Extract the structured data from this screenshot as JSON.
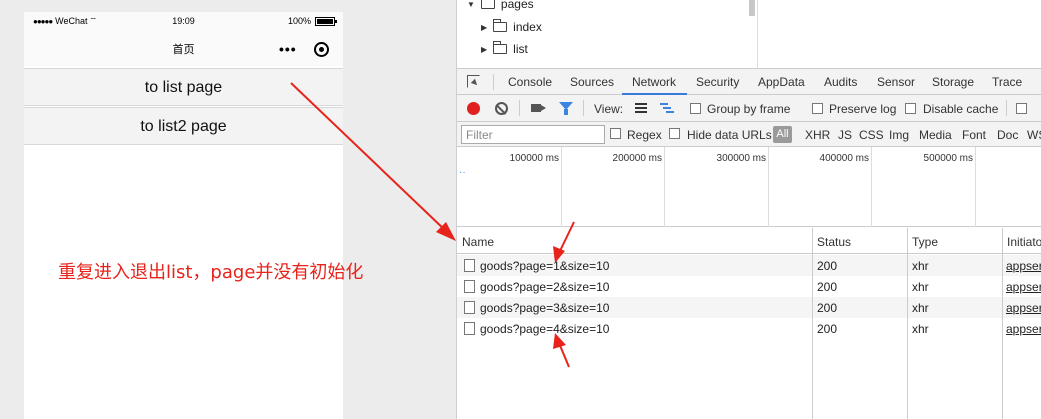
{
  "phone": {
    "status": {
      "dots": "●●●●●",
      "carrier": "WeChat",
      "time": "19:09",
      "battery": "100%"
    },
    "nav_title": "首页",
    "more_label": "•••",
    "buttons": [
      {
        "label": "to list page"
      },
      {
        "label": "to list2 page"
      }
    ]
  },
  "annotation": {
    "text": "重复进入退出list，page并没有初始化",
    "color": "#e8231b"
  },
  "devtools": {
    "tree": [
      {
        "label": "pages",
        "expanded": true
      },
      {
        "label": "index",
        "expanded": false
      },
      {
        "label": "list",
        "expanded": false
      }
    ],
    "tabs": [
      "Console",
      "Sources",
      "Network",
      "Security",
      "AppData",
      "Audits",
      "Sensor",
      "Storage",
      "Trace"
    ],
    "active_tab": "Network",
    "toolbar": {
      "view_label": "View:",
      "group_by_frame": "Group by frame",
      "preserve_log": "Preserve log",
      "disable_cache": "Disable cache"
    },
    "filter": {
      "placeholder": "Filter",
      "regex": "Regex",
      "hide_data_urls": "Hide data URLs",
      "all": "All",
      "types": [
        "XHR",
        "JS",
        "CSS",
        "Img",
        "Media",
        "Font",
        "Doc",
        "WS"
      ]
    },
    "overview_ticks": [
      "100000 ms",
      "200000 ms",
      "300000 ms",
      "400000 ms",
      "500000 ms"
    ],
    "columns": [
      "Name",
      "Status",
      "Type",
      "Initiator"
    ],
    "requests": [
      {
        "name": "goods?page=1&size=10",
        "status": "200",
        "type": "xhr",
        "initiator": "appservice"
      },
      {
        "name": "goods?page=2&size=10",
        "status": "200",
        "type": "xhr",
        "initiator": "appservice"
      },
      {
        "name": "goods?page=3&size=10",
        "status": "200",
        "type": "xhr",
        "initiator": "appservice"
      },
      {
        "name": "goods?page=4&size=10",
        "status": "200",
        "type": "xhr",
        "initiator": "appservice"
      }
    ]
  }
}
